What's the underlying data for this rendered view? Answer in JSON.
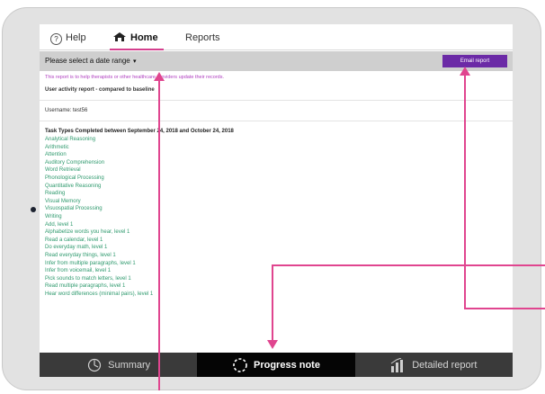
{
  "tabs": {
    "help_icon": "?",
    "help": "Help",
    "home": "Home",
    "reports": "Reports"
  },
  "date_bar": {
    "select_label": "Please select a date range",
    "caret": "▾",
    "email_button": "Email report"
  },
  "report": {
    "purpose": "This report is to help therapists or other healthcare providers update their records.",
    "title": "User activity report - compared to baseline",
    "username": "Username: test56",
    "task_heading": "Task Types Completed between September 24, 2018 and October 24, 2018",
    "tasks": [
      "Analytical Reasoning",
      "Arithmetic",
      "Attention",
      "Auditory Comprehension",
      "Word Retrieval",
      "Phonological Processing",
      "Quantitative Reasoning",
      "Reading",
      "Visual Memory",
      "Visuospatial Processing",
      "Writing",
      "Add, level 1",
      "Alphabetize words you hear, level 1",
      "Read a calendar, level 1",
      "Do everyday math, level 1",
      "Read everyday things, level 1",
      "Infer from multiple paragraphs, level 1",
      "Infer from voicemail, level 1",
      "Pick sounds to match letters, level 1",
      "Read multiple paragraphs, level 1",
      "Hear word differences (minimal pairs), level 1"
    ]
  },
  "bottom_nav": {
    "summary": "Summary",
    "progress_note": "Progress note",
    "detailed_report": "Detailed report"
  },
  "colors": {
    "accent": "#d43f8d",
    "email_button": "#6b2aa6",
    "task_text": "#2f9a6e",
    "purpose_text": "#b040c0",
    "annotation": "#e0458f"
  },
  "icons": [
    "help-icon",
    "home-icon",
    "summary-icon",
    "progress-note-icon",
    "detailed-report-icon"
  ]
}
